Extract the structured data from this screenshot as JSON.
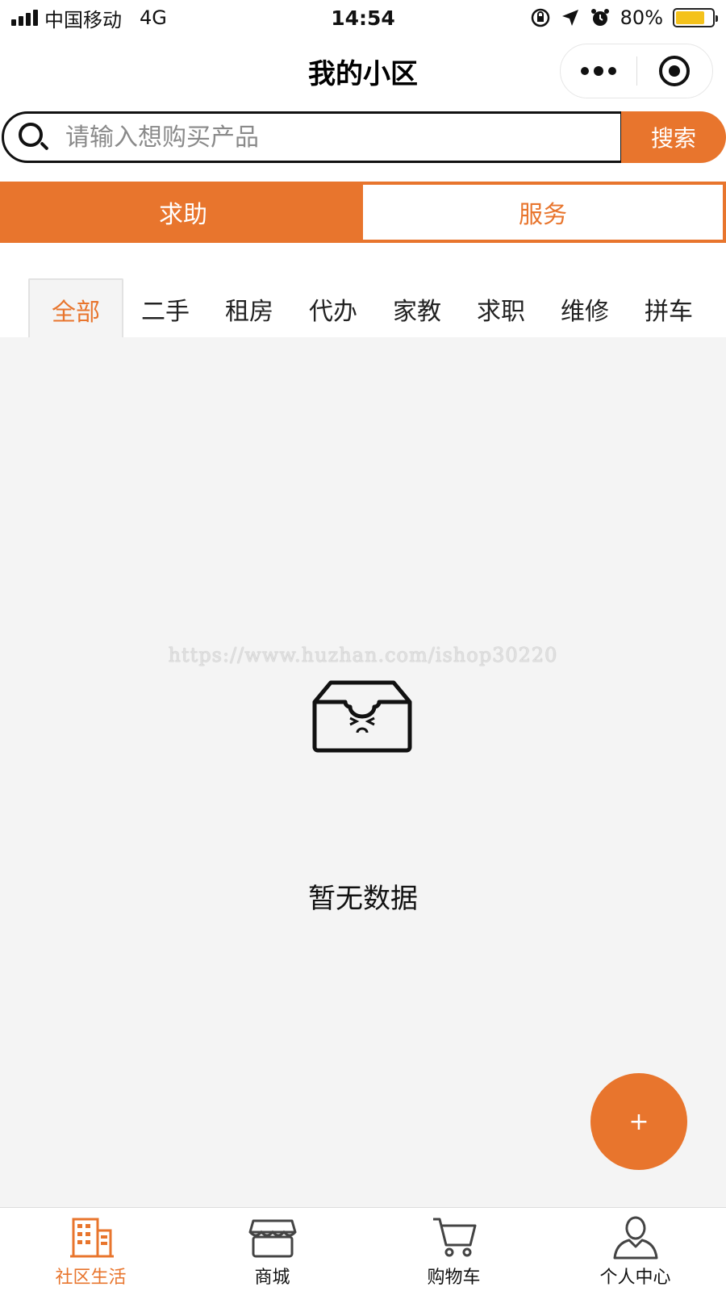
{
  "status_bar": {
    "carrier": "中国移动",
    "network": "4G",
    "time": "14:54",
    "battery": "80%",
    "battery_level": 0.8
  },
  "nav": {
    "title": "我的小区",
    "more_icon": "more-dots-icon",
    "close_icon": "target-circle-icon"
  },
  "search": {
    "placeholder": "请输入想购买产品",
    "button_label": "搜索"
  },
  "segment_tabs": [
    {
      "label": "求助",
      "active": false
    },
    {
      "label": "服务",
      "active": true
    }
  ],
  "category_tabs": [
    {
      "label": "全部",
      "active": true
    },
    {
      "label": "二手"
    },
    {
      "label": "租房"
    },
    {
      "label": "代办"
    },
    {
      "label": "家教"
    },
    {
      "label": "求职"
    },
    {
      "label": "维修"
    },
    {
      "label": "拼车"
    }
  ],
  "content": {
    "watermark": "https://www.huzhan.com/ishop30220",
    "empty_text": "暂无数据",
    "empty_icon": "empty-box-icon"
  },
  "fab": {
    "label": "+"
  },
  "tab_bar": [
    {
      "label": "社区生活",
      "icon": "building-icon",
      "active": true
    },
    {
      "label": "商城",
      "icon": "store-icon"
    },
    {
      "label": "购物车",
      "icon": "cart-icon"
    },
    {
      "label": "个人中心",
      "icon": "user-icon"
    }
  ],
  "colors": {
    "accent": "#e8752d",
    "background": "#f4f4f4",
    "battery": "#f4c21b"
  }
}
